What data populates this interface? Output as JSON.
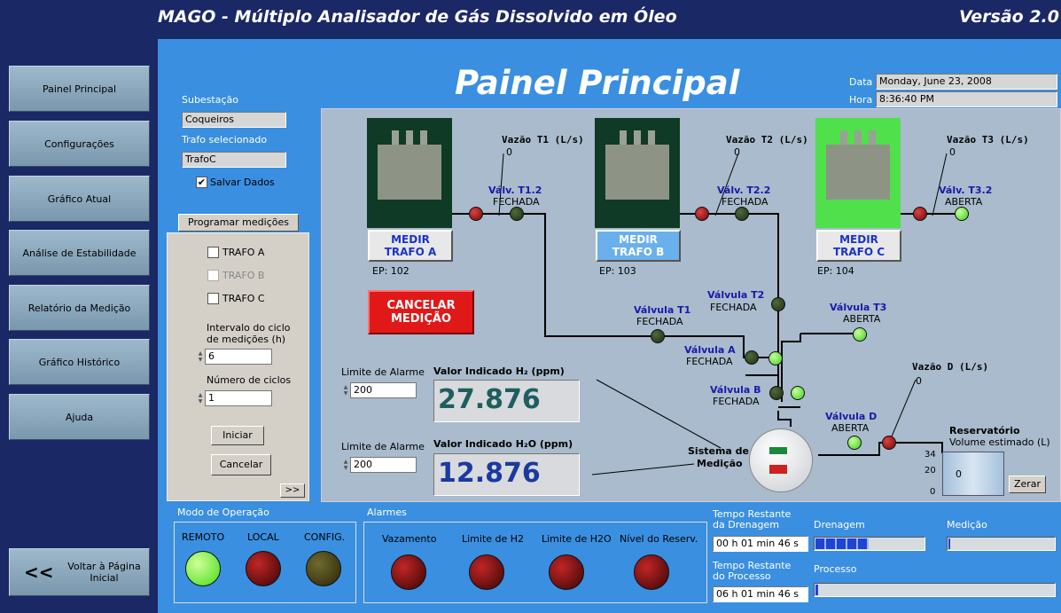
{
  "app": {
    "title": "MAGO - Múltiplo Analisador de Gás Dissolvido em Óleo",
    "version": "Versão 2.0"
  },
  "nav": {
    "items": [
      {
        "label": "Painel Principal"
      },
      {
        "label": "Configurações"
      },
      {
        "label": "Gráfico Atual"
      },
      {
        "label": "Análise de Estabilidade"
      },
      {
        "label": "Relatório da Medição"
      },
      {
        "label": "Gráfico Histórico"
      },
      {
        "label": "Ajuda"
      }
    ],
    "back_arrow": "<<",
    "back_label": "Voltar à Página Inicial"
  },
  "main": {
    "title": "Painel Principal",
    "date_label": "Data",
    "date_value": "Monday, June 23, 2008",
    "time_label": "Hora",
    "time_value": "8:36:40 PM",
    "substation_label": "Subestação",
    "substation_value": "Coqueiros",
    "trafo_label": "Trafo selecionado",
    "trafo_value": "TrafoC",
    "save_data_label": "Salvar Dados",
    "save_data_checked": true
  },
  "programming": {
    "button_label": "Programar medições",
    "options": [
      {
        "label": "TRAFO A",
        "checked": false,
        "enabled": true
      },
      {
        "label": "TRAFO B",
        "checked": false,
        "enabled": false
      },
      {
        "label": "TRAFO C",
        "checked": false,
        "enabled": true
      }
    ],
    "interval_label_1": "Intervalo do ciclo",
    "interval_label_2": "de medições (h)",
    "interval_value": "6",
    "cycles_label": "Número de ciclos",
    "cycles_value": "1",
    "start_label": "Iniciar",
    "cancel_label": "Cancelar",
    "more_label": ">>"
  },
  "diagram": {
    "trafos": [
      {
        "button": "MEDIR TRAFO A",
        "ep": "EP: 102",
        "flow_label": "Vazão T1 (L/s)",
        "flow_value": "0",
        "valve_label": "Válv. T1.2",
        "valve_state": "FECHADA"
      },
      {
        "button": "MEDIR TRAFO B",
        "ep": "EP: 103",
        "flow_label": "Vazão T2 (L/s)",
        "flow_value": "0",
        "valve_label": "Válv. T2.2",
        "valve_state": "FECHADA"
      },
      {
        "button": "MEDIR TRAFO C",
        "ep": "EP: 104",
        "flow_label": "Vazão T3 (L/s)",
        "flow_value": "0",
        "valve_label": "Válv. T3.2",
        "valve_state": "ABERTA"
      }
    ],
    "cancel_label": "CANCELAR MEDIÇÃO",
    "valves": {
      "t1": {
        "label": "Válvula T1",
        "state": "FECHADA"
      },
      "t2": {
        "label": "Válvula T2",
        "state": "FECHADA"
      },
      "t3": {
        "label": "Válvula T3",
        "state": "ABERTA"
      },
      "a": {
        "label": "Válvula A",
        "state": "FECHADA"
      },
      "b": {
        "label": "Válvula B",
        "state": "FECHADA"
      },
      "d": {
        "label": "Válvula D",
        "state": "ABERTA"
      }
    },
    "flow_d_label": "Vazão D (L/s)",
    "flow_d_value": "0",
    "alarm_limit_label": "Limite de Alarme",
    "h2_limit": "200",
    "h2o_limit": "200",
    "h2_label": "Valor Indicado H₂ (ppm)",
    "h2_value": "27.876",
    "h2o_label": "Valor Indicado H₂O (ppm)",
    "h2o_value": "12.876",
    "system_label_1": "Sistema de",
    "system_label_2": "Medição",
    "reservoir_label": "Reservatório",
    "reservoir_sub": "Volume estimado (L)",
    "reservoir_ticks": [
      "34",
      "20",
      "0"
    ],
    "reservoir_value": "0",
    "zero_label": "Zerar"
  },
  "bottom": {
    "mode_label": "Modo de Operação",
    "modes": [
      {
        "label": "REMOTO",
        "state": "green"
      },
      {
        "label": "LOCAL",
        "state": "red"
      },
      {
        "label": "CONFIG.",
        "state": "olive"
      }
    ],
    "alarms_label": "Alarmes",
    "alarms": [
      {
        "label": "Vazamento"
      },
      {
        "label": "Limite de H2"
      },
      {
        "label": "Limite de H2O"
      },
      {
        "label": "Nível do Reserv."
      }
    ],
    "drain_time_label_1": "Tempo Restante",
    "drain_time_label_2": "da Drenagem",
    "drain_time_value": "00 h 01 min 46 s",
    "process_time_label_1": "Tempo Restante",
    "process_time_label_2": "do Processo",
    "process_time_value": "06 h 01 min 46 s",
    "drainage_label": "Drenagem",
    "drainage_progress": 0.5,
    "measurement_label": "Medição",
    "measurement_progress": 0.01,
    "process_label": "Processo",
    "process_progress": 0.01
  },
  "colors": {
    "background": "#1a2866",
    "main": "#3a8fe0",
    "diagram": "#a9bbcc",
    "h2_text": "#1e5e5e",
    "h2o_text": "#1a3aa0",
    "cancel": "#e01818"
  }
}
